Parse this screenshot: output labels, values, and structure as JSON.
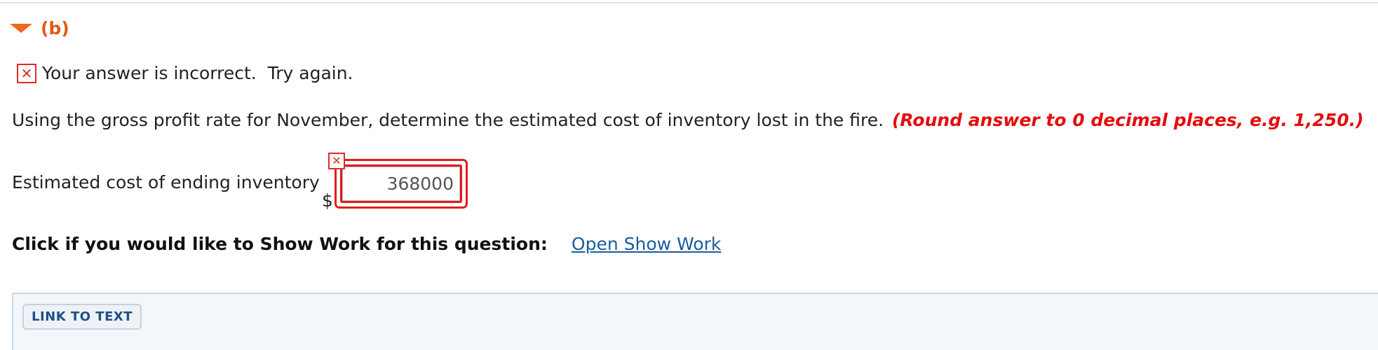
{
  "part": {
    "label": "(b)"
  },
  "feedback": {
    "icon": "x-icon",
    "message": "Your answer is incorrect.  Try again."
  },
  "question": {
    "text": "Using the gross profit rate for November, determine the estimated cost of inventory lost in the fire.",
    "hint": "(Round answer to 0 decimal places, e.g. 1,250.)"
  },
  "answer": {
    "label": "Estimated cost of ending inventory",
    "currency": "$",
    "value": "368000",
    "status": "incorrect"
  },
  "show_work": {
    "prompt": "Click if you would like to Show Work for this question:",
    "link": "Open Show Work"
  },
  "link_to_text": {
    "label": "LINK TO TEXT"
  },
  "colors": {
    "accent_orange": "#e05a12",
    "error_red": "#e11d1d",
    "link_blue": "#1a5c9c",
    "panel_bg": "#f3f7fb"
  }
}
